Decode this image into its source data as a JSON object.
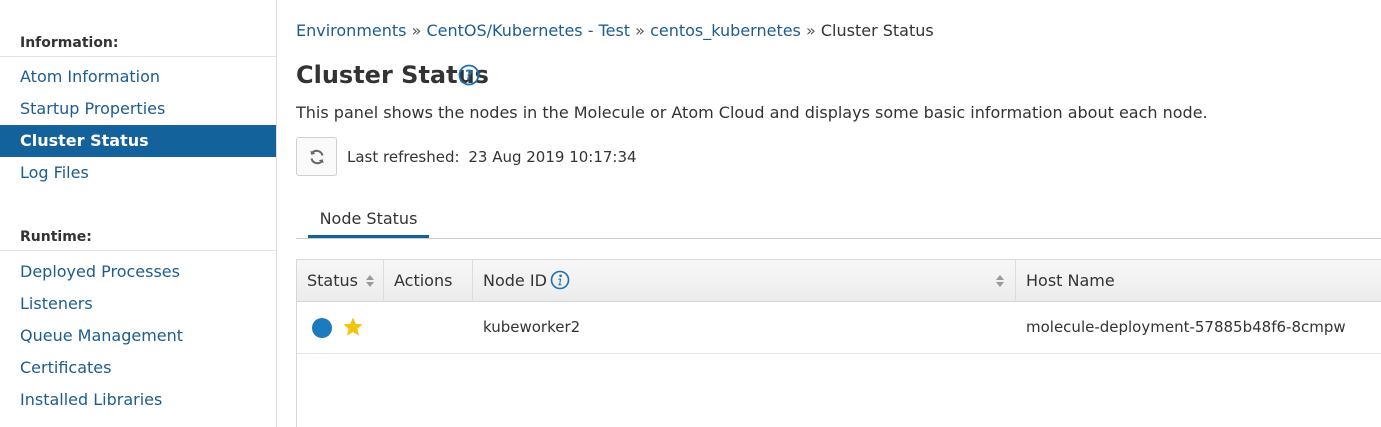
{
  "sidebar": {
    "sections": [
      {
        "heading": "Information:",
        "items": [
          "Atom Information",
          "Startup Properties",
          "Cluster Status",
          "Log Files"
        ]
      },
      {
        "heading": "Runtime:",
        "items": [
          "Deployed Processes",
          "Listeners",
          "Queue Management",
          "Certificates",
          "Installed Libraries"
        ]
      }
    ],
    "active_item": "Cluster Status"
  },
  "breadcrumb": {
    "items": [
      "Environments",
      "CentOS/Kubernetes - Test",
      "centos_kubernetes"
    ],
    "separator": "»",
    "current": "Cluster Status"
  },
  "page": {
    "title": "Cluster Status",
    "description": "This panel shows the nodes in the Molecule or Atom Cloud and displays some basic information about each node.",
    "last_refreshed_label": "Last refreshed:",
    "last_refreshed_value": "23 Aug 2019 10:17:34"
  },
  "tabs": [
    {
      "label": "Node Status",
      "active": true
    }
  ],
  "table": {
    "columns": [
      "Status",
      "Actions",
      "Node ID",
      "Host Name"
    ],
    "rows": [
      {
        "status": "online",
        "is_head_node": true,
        "actions": "",
        "node_id": "kubeworker2",
        "host_name": "molecule-deployment-57885b48f6-8cmpw"
      }
    ]
  },
  "colors": {
    "accent": "#14629c",
    "link": "#1d5c8f",
    "status_online": "#1a7bbf",
    "star": "#f2c40f"
  },
  "icons": {
    "help": "question-circle-icon",
    "refresh": "refresh-icon",
    "sort": "sort-icon",
    "info": "info-circle-icon",
    "status": "status-dot-icon",
    "head_node": "star-icon"
  }
}
